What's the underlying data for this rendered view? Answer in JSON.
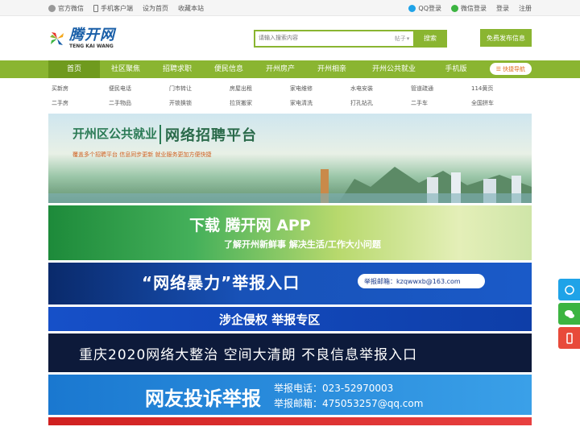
{
  "topbar": {
    "left": [
      "官方微信",
      "手机客户端",
      "设为首页",
      "收藏本站"
    ],
    "right": [
      "QQ登录",
      "微信登录",
      "登录",
      "注册"
    ]
  },
  "logo": {
    "cn": "腾开网",
    "en": "TENG KAI WANG"
  },
  "search": {
    "placeholder": "请输入搜索内容",
    "select": "帖子",
    "button": "搜索"
  },
  "post_button": "免费发布信息",
  "nav": {
    "items": [
      "首页",
      "社区聚焦",
      "招聘求职",
      "便民信息",
      "开州房产",
      "开州相亲",
      "开州公共就业",
      "手机版"
    ],
    "quick": "快捷导航"
  },
  "subnav": {
    "row1": [
      "买新房",
      "便民电话",
      "门市转让",
      "房屋出租",
      "家电维修",
      "水电安装",
      "管道疏通",
      "114黄页"
    ],
    "row2": [
      "二手房",
      "二手物品",
      "开锁换锁",
      "拉货搬家",
      "家电清洗",
      "打孔钻孔",
      "二手车",
      "全国拼车"
    ]
  },
  "banners": {
    "b1": {
      "t1": "开州区公共就业",
      "t2": "网络招聘平台",
      "t3": "覆盖多个招聘平台 信息同步更新 就业服务更加方便快捷"
    },
    "b2": {
      "t1": "下载 腾开网 APP",
      "t2": "了解开州新鲜事  解决生活/工作大小问题"
    },
    "b3": {
      "t1": "“网络暴力”举报入口",
      "mail": "举报邮箱：kzqwwxb@163.com"
    },
    "b4": {
      "t1": "涉企侵权    举报专区"
    },
    "b5": {
      "t1": "重庆2020网络大整治 空间大清朗 不良信息举报入口"
    },
    "b6": {
      "t1": "网友投诉举报",
      "tel": "举报电话：023-52970003",
      "mail": "举报邮箱：475053257@qq.com"
    }
  },
  "colors": {
    "accent": "#8ab531",
    "nav_active": "#6f9a1e",
    "brand_blue": "#1a5fa8"
  }
}
